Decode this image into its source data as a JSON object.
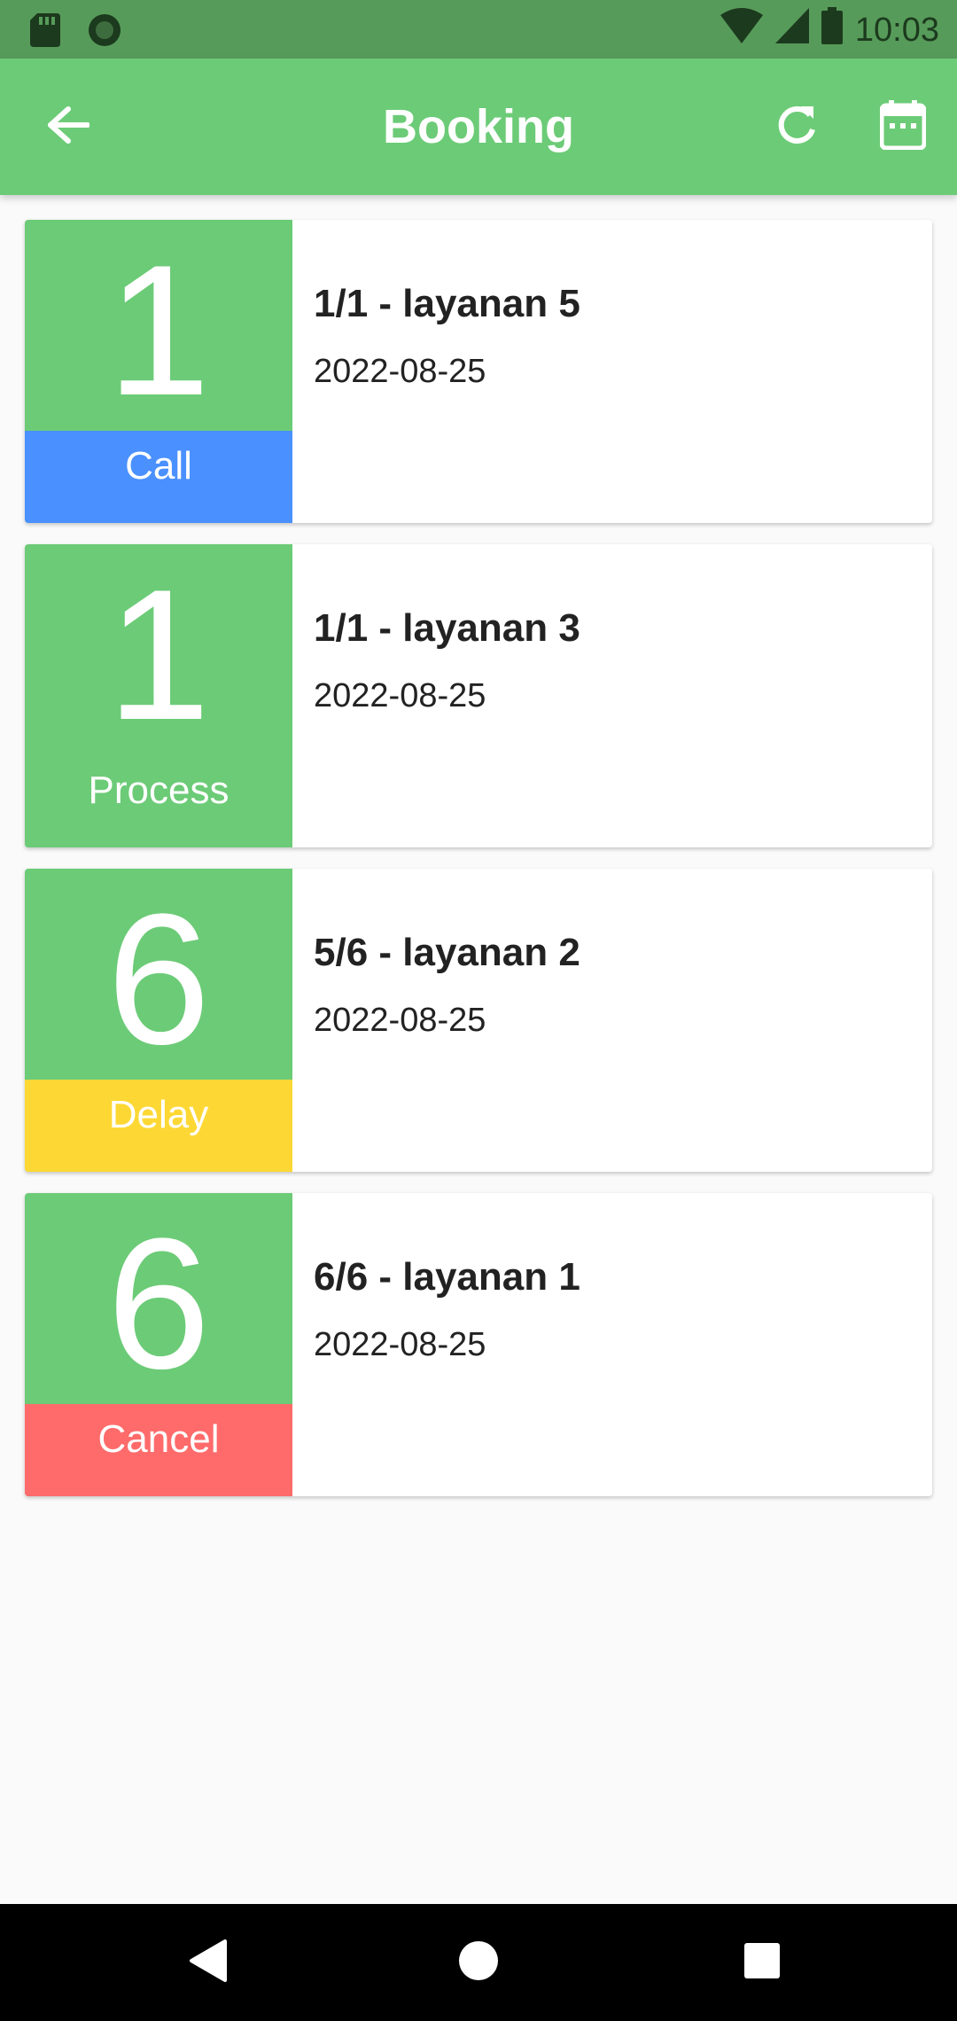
{
  "status_bar": {
    "time": "10:03",
    "icons": [
      "sd-card-icon",
      "circle-notification-icon",
      "wifi-icon",
      "signal-icon",
      "battery-icon"
    ]
  },
  "app_bar": {
    "title": "Booking",
    "icons": [
      "back-arrow-icon",
      "refresh-icon",
      "calendar-icon"
    ]
  },
  "bookings": [
    {
      "number": "1",
      "status": "Call",
      "status_color": "#4a90ff",
      "name": "1/1 - layanan 5",
      "date": "2022-08-25"
    },
    {
      "number": "1",
      "status": "Process",
      "status_color": "#6ccb77",
      "name": "1/1 - layanan 3",
      "date": "2022-08-25"
    },
    {
      "number": "6",
      "status": "Delay",
      "status_color": "#fdd835",
      "name": "5/6 - layanan 2",
      "date": "2022-08-25"
    },
    {
      "number": "6",
      "status": "Cancel",
      "status_color": "#ff6b6b",
      "name": "6/6 - layanan 1",
      "date": "2022-08-25"
    }
  ],
  "colors": {
    "primary": "#6ccb77",
    "status_bar": "#579b5a",
    "background": "#fafafa"
  },
  "nav_bar": {
    "icons": [
      "back-triangle-icon",
      "home-circle-icon",
      "recents-square-icon"
    ]
  }
}
